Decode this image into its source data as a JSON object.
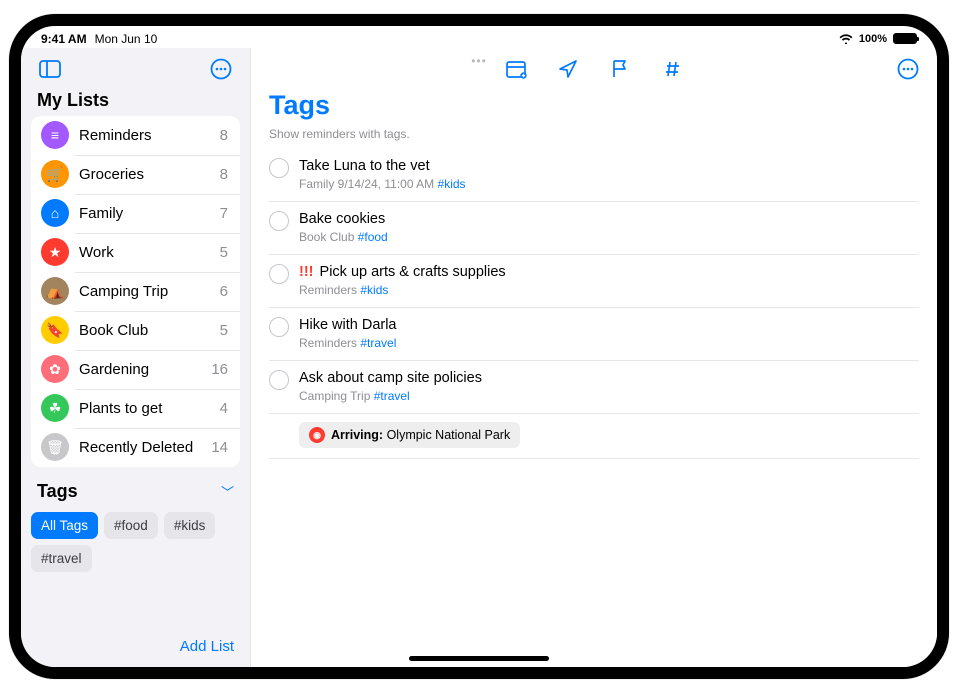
{
  "status": {
    "time": "9:41 AM",
    "date": "Mon Jun 10",
    "battery": "100%"
  },
  "sidebar": {
    "section_title": "My Lists",
    "lists": [
      {
        "name": "Reminders",
        "count": "8",
        "color": "#a259ff",
        "icon": "list"
      },
      {
        "name": "Groceries",
        "count": "8",
        "color": "#ff9500",
        "icon": "cart"
      },
      {
        "name": "Family",
        "count": "7",
        "color": "#007aff",
        "icon": "house"
      },
      {
        "name": "Work",
        "count": "5",
        "color": "#ff3b30",
        "icon": "star"
      },
      {
        "name": "Camping Trip",
        "count": "6",
        "color": "#a2845e",
        "icon": "tent"
      },
      {
        "name": "Book Club",
        "count": "5",
        "color": "#ffcc00",
        "icon": "bookmark"
      },
      {
        "name": "Gardening",
        "count": "16",
        "color": "#ff6d79",
        "icon": "flower"
      },
      {
        "name": "Plants to get",
        "count": "4",
        "color": "#34c759",
        "icon": "leaf"
      },
      {
        "name": "Recently Deleted",
        "count": "14",
        "color": "#c7c7cc",
        "icon": "trash"
      }
    ],
    "tags_title": "Tags",
    "tags": [
      {
        "label": "All Tags",
        "active": true
      },
      {
        "label": "#food",
        "active": false
      },
      {
        "label": "#kids",
        "active": false
      },
      {
        "label": "#travel",
        "active": false
      }
    ],
    "add_list": "Add List"
  },
  "main": {
    "title": "Tags",
    "subtitle": "Show reminders with tags.",
    "reminders": [
      {
        "title": "Take Luna to the vet",
        "list": "Family",
        "date": "9/14/24, 11:00 AM",
        "tag": "#kids",
        "priority": ""
      },
      {
        "title": "Bake cookies",
        "list": "Book Club",
        "date": "",
        "tag": "#food",
        "priority": ""
      },
      {
        "title": "Pick up arts & crafts supplies",
        "list": "Reminders",
        "date": "",
        "tag": "#kids",
        "priority": "!!!"
      },
      {
        "title": "Hike with Darla",
        "list": "Reminders",
        "date": "",
        "tag": "#travel",
        "priority": ""
      },
      {
        "title": "Ask about camp site policies",
        "list": "Camping Trip",
        "date": "",
        "tag": "#travel",
        "priority": "",
        "location_label": "Arriving:",
        "location": "Olympic National Park"
      }
    ]
  },
  "icons": {
    "list": "≡",
    "cart": "🛒",
    "house": "⌂",
    "star": "★",
    "tent": "⛺",
    "bookmark": "🔖",
    "flower": "✿",
    "leaf": "☘",
    "trash": "🗑"
  }
}
